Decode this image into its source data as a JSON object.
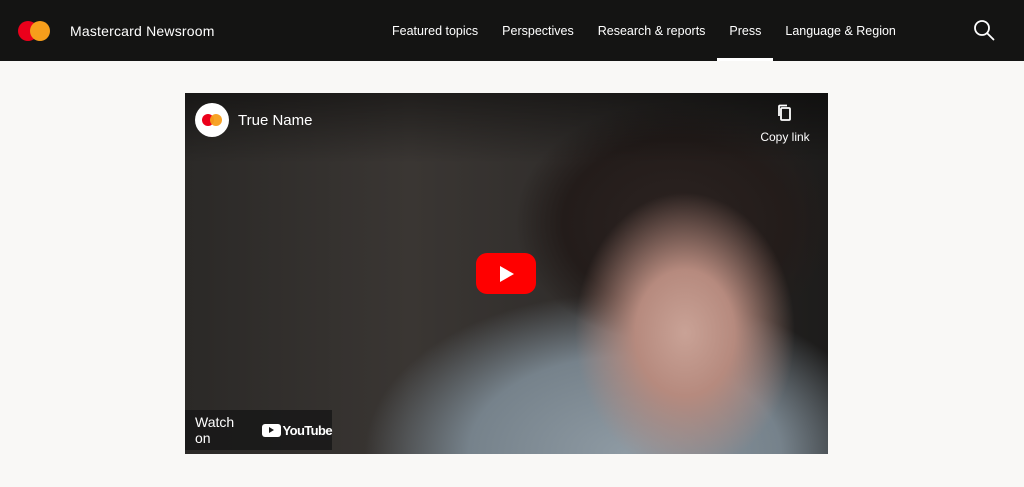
{
  "header": {
    "brand_name": "Mastercard Newsroom",
    "nav": [
      {
        "label": "Featured topics",
        "active": false
      },
      {
        "label": "Perspectives",
        "active": false
      },
      {
        "label": "Research & reports",
        "active": false
      },
      {
        "label": "Press",
        "active": true
      },
      {
        "label": "Language & Region",
        "active": false
      }
    ],
    "search_icon": "search-icon"
  },
  "video": {
    "title": "True Name",
    "copy_link_label": "Copy link",
    "watch_on_label": "Watch on",
    "youtube_wordmark": "YouTube",
    "play_icon": "play-icon"
  },
  "colors": {
    "header_bg": "#141413",
    "page_bg": "#f9f8f6",
    "mastercard_red": "#eb001b",
    "mastercard_orange": "#f79e1b",
    "youtube_red": "#ff0000"
  }
}
